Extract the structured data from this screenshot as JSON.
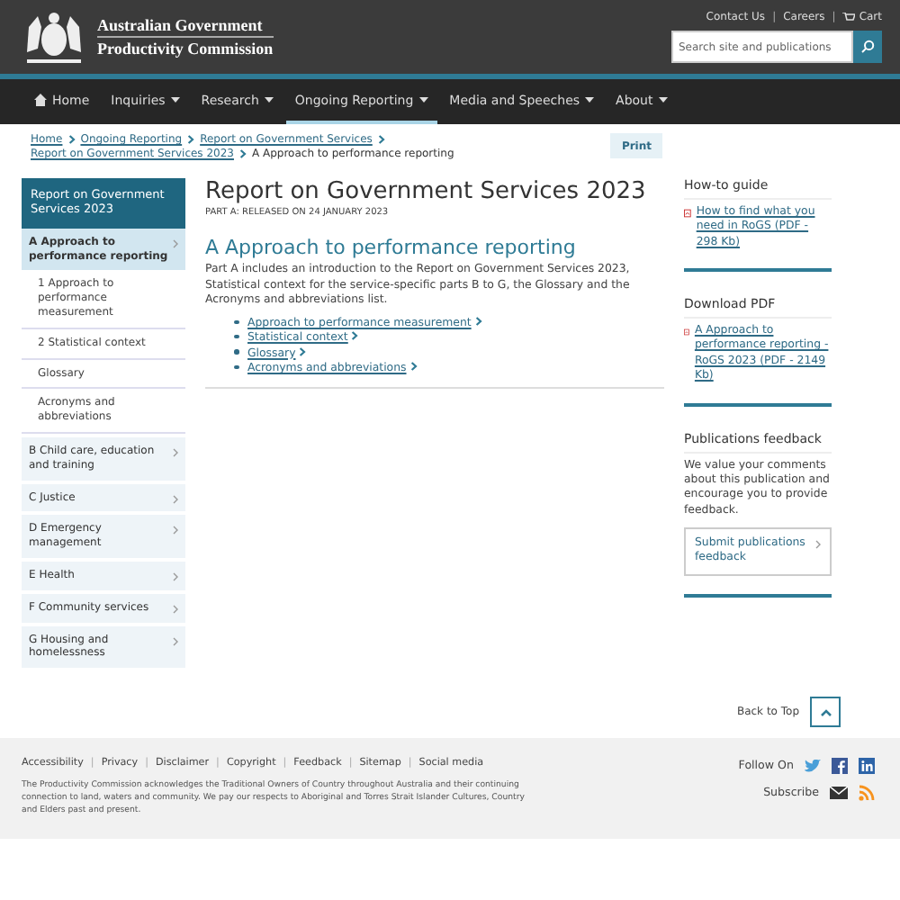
{
  "header": {
    "brand": [
      "Australian Government",
      "Productivity Commission"
    ],
    "top_links": [
      {
        "label": "Contact Us"
      },
      {
        "separator": "|",
        "label": "Careers"
      },
      {
        "separator": "|",
        "label": "Cart"
      }
    ],
    "search": {
      "placeholder": "Search site and publications"
    }
  },
  "nav": [
    {
      "label": "Home",
      "kind": "home",
      "selected": false
    },
    {
      "label": "Inquiries",
      "kind": "menu",
      "selected": false
    },
    {
      "label": "Research",
      "kind": "menu",
      "selected": false
    },
    {
      "label": "Ongoing Reporting",
      "kind": "menu",
      "selected": true
    },
    {
      "label": "Media and Speeches",
      "kind": "menu",
      "selected": false
    },
    {
      "label": "About",
      "kind": "menu",
      "selected": false
    }
  ],
  "breadcrumbs": [
    {
      "label": "Home",
      "link": true
    },
    {
      "label": "Ongoing Reporting",
      "link": true
    },
    {
      "label": "Report on Government Services",
      "link": true
    },
    {
      "label": "Report on Government Services 2023",
      "link": true
    },
    {
      "label": "A Approach to performance reporting",
      "link": false
    }
  ],
  "print_button": "Print",
  "sidebar": {
    "heading": "Report on Government Services 2023",
    "items": [
      {
        "label": "A Approach to performance reporting",
        "selected": true,
        "children": [
          {
            "label": "1 Approach to performance measurement"
          },
          {
            "label": "2 Statistical context"
          },
          {
            "label": "Glossary"
          },
          {
            "label": "Acronyms and abbreviations"
          }
        ]
      },
      {
        "label": "B Child care, education and training",
        "selected": false
      },
      {
        "label": "C Justice",
        "selected": false
      },
      {
        "label": "D Emergency management",
        "selected": false
      },
      {
        "label": "E Health",
        "selected": false
      },
      {
        "label": "F Community services",
        "selected": false
      },
      {
        "label": "G Housing and homelessness",
        "selected": false
      }
    ]
  },
  "main": {
    "title": "Report on Government Services 2023",
    "subtitle": "PART A: RELEASED ON 24 JANUARY 2023",
    "section_title": "A Approach to performance reporting",
    "intro": "Part A includes an introduction to the Report on Government Services 2023, Statistical context for the service-specific parts B to G, the Glossary and the Acronyms and abbreviations list.",
    "links": [
      "Approach to performance measurement",
      "Statistical context",
      "Glossary",
      "Acronyms and abbreviations"
    ]
  },
  "aside": [
    {
      "kind": "pdf",
      "title": "How-to guide",
      "link": "How to find what you need in RoGS (PDF - 298 Kb)"
    },
    {
      "kind": "pdf",
      "title": "Download PDF",
      "link": "A Approach to performance reporting - RoGS 2023 (PDF - 2149 Kb)"
    },
    {
      "kind": "feedback",
      "title": "Publications feedback",
      "text": "We value your comments about this publication and encourage you to provide feedback.",
      "button": "Submit publications feedback"
    }
  ],
  "back_to_top": "Back to Top",
  "footer": {
    "links": [
      {
        "label": "Accessibility"
      },
      {
        "separator": "|",
        "label": "Privacy"
      },
      {
        "separator": "|",
        "label": "Disclaimer"
      },
      {
        "separator": "|",
        "label": "Copyright"
      },
      {
        "separator": "|",
        "label": "Feedback"
      },
      {
        "separator": "|",
        "label": "Sitemap"
      },
      {
        "separator": "|",
        "label": "Social media"
      }
    ],
    "acknowledgement": "The Productivity Commission acknowledges the Traditional Owners of Country throughout Australia and their continuing connection to land, waters and community. We pay our respects to Aboriginal and Torres Strait Islander Cultures, Country and Elders past and present.",
    "follow_on": "Follow On",
    "subscribe": "Subscribe"
  }
}
